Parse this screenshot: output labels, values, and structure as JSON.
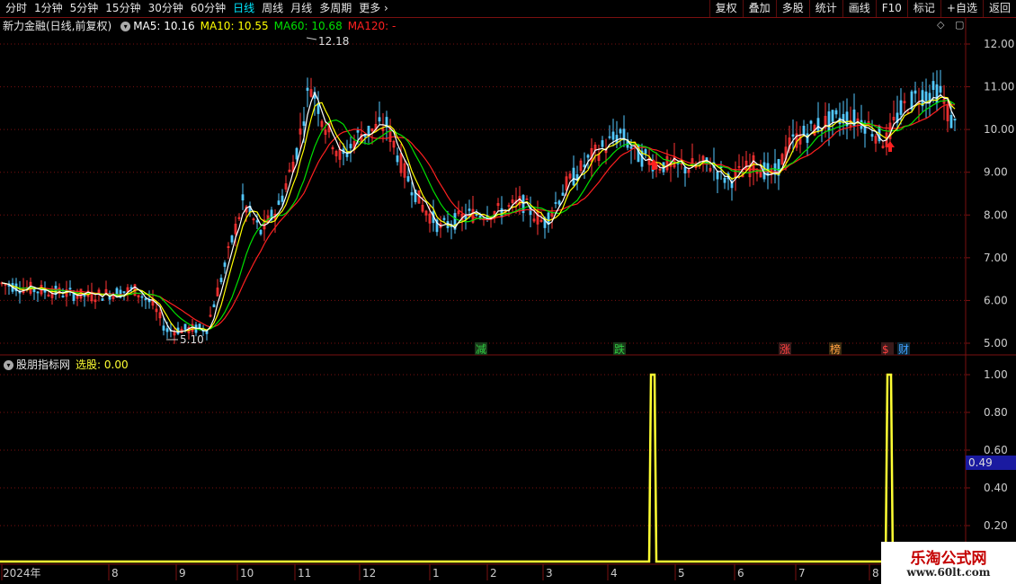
{
  "toolbar": {
    "tabs": [
      "分时",
      "1分钟",
      "5分钟",
      "15分钟",
      "30分钟",
      "60分钟",
      "日线",
      "周线",
      "月线",
      "多周期",
      "更多"
    ],
    "active_tab": 6,
    "more_arrow": "›",
    "right_buttons": [
      "复权",
      "叠加",
      "多股",
      "统计",
      "画线",
      "F10",
      "标记",
      "+自选",
      "返回"
    ]
  },
  "main": {
    "title": "新力金融(日线,前复权)",
    "ma5": "MA5: 10.16",
    "ma10": "MA10: 10.55",
    "ma60": "MA60: 10.68",
    "ma120": "MA120: -",
    "high_label": "12.18",
    "low_label": "5.10",
    "y_ticks": [
      "12.00",
      "11.00",
      "10.00",
      "9.00",
      "8.00",
      "7.00",
      "6.00",
      "5.00"
    ],
    "events": [
      {
        "text": "减",
        "color": "#2ecc40",
        "bg": "#1a3a1a"
      },
      {
        "text": "跌",
        "color": "#2ecc40",
        "bg": "#1a3a1a"
      },
      {
        "text": "涨",
        "color": "#ff4040",
        "bg": "#3a1a1a"
      },
      {
        "text": "榜",
        "color": "#ffa040",
        "bg": "#3a2a10"
      },
      {
        "text": "$",
        "color": "#ff4040",
        "bg": "#3a1a1a"
      },
      {
        "text": "财",
        "color": "#40a0ff",
        "bg": "#102a3a"
      }
    ]
  },
  "indicator": {
    "title": "股朋指标网",
    "value_label": "选股: 0.00",
    "y_ticks": [
      "1.00",
      "0.80",
      "0.60",
      "0.40",
      "0.20"
    ],
    "cursor_value": "0.49"
  },
  "x_axis": {
    "labels": [
      "2024年",
      "8",
      "9",
      "10",
      "11",
      "12",
      "1",
      "2",
      "3",
      "4",
      "5",
      "6",
      "7",
      "8"
    ]
  },
  "watermark": {
    "line1": "乐淘公式网",
    "line2": "www.60lt.com"
  },
  "colors": {
    "up": "#ff3333",
    "down": "#53c8ff",
    "ma5": "#ffffff",
    "ma10": "#ffff00",
    "ma60": "#00e000",
    "ma120": "#ff2020",
    "grid": "#7a1010",
    "signal": "#ffff33",
    "active_tab": "#00e8ff"
  },
  "chart_data": [
    {
      "type": "candlestick",
      "title": "新力金融(日线,前复权)",
      "ylim": [
        4.7,
        12.5
      ],
      "x_categories": [
        "2024年",
        "8",
        "9",
        "10",
        "11",
        "12",
        "1",
        "2",
        "3",
        "4",
        "5",
        "6",
        "7",
        "8"
      ],
      "series": [
        {
          "name": "MA5",
          "values": [
            6.35,
            6.3,
            6.2,
            6.15,
            6.1,
            6.25,
            6.1,
            5.6,
            5.2,
            5.3,
            7.2,
            8.2,
            10.7,
            9.6,
            10.1,
            9.4,
            7.8,
            8.1,
            8.3,
            8.0,
            9.3,
            9.6,
            9.2,
            9.1,
            8.9,
            8.6,
            9.3,
            10.3,
            10.3,
            10.9,
            10.8
          ]
        },
        {
          "name": "MA60",
          "values": [
            6.3,
            6.25,
            6.2,
            6.15,
            6.1,
            6.15,
            6.1,
            5.6,
            5.3,
            5.4,
            6.9,
            7.8,
            9.1,
            9.8,
            9.9,
            9.0,
            8.0,
            8.0,
            8.2,
            7.9,
            9.5,
            9.5,
            9.1,
            9.2,
            9.0,
            9.0,
            9.8,
            10.1,
            10.2,
            10.8,
            10.7
          ]
        }
      ],
      "annotations": [
        {
          "text": "12.18",
          "value": 12.18
        },
        {
          "text": "5.10",
          "value": 5.1
        }
      ]
    },
    {
      "type": "line",
      "title": "股朋指标网",
      "ylim": [
        0,
        1.05
      ],
      "series": [
        {
          "name": "选股",
          "value_label": "选股: 0.00",
          "spikes": [
            {
              "x_label": "4",
              "value": 1.0
            },
            {
              "x_label": "8",
              "value": 1.0
            }
          ]
        }
      ]
    }
  ]
}
